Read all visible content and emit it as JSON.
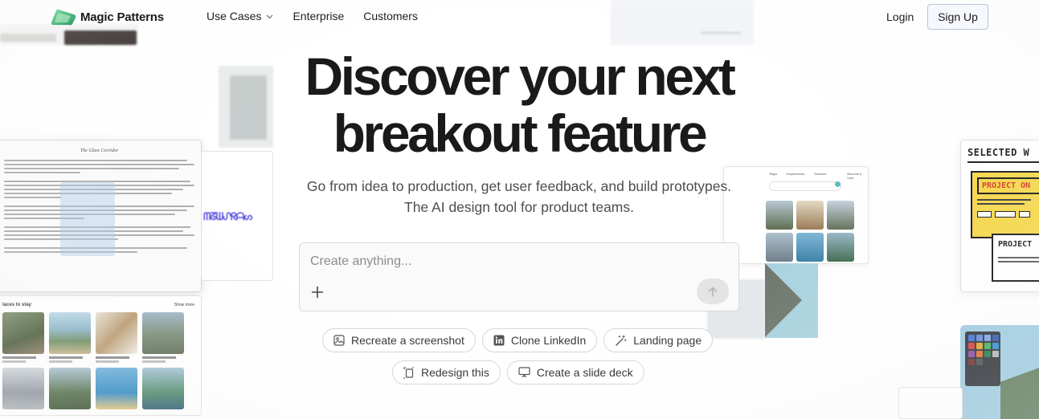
{
  "nav": {
    "brand": "Magic Patterns",
    "links": [
      {
        "label": "Use Cases",
        "has_dropdown": true
      },
      {
        "label": "Enterprise"
      },
      {
        "label": "Customers"
      }
    ],
    "login_label": "Login",
    "signup_label": "Sign Up"
  },
  "hero": {
    "title": "Discover your next breakout feature",
    "subtitle_line1": "Go from idea to production, get user feedback, and build prototypes.",
    "subtitle_line2": "The AI design tool for product teams."
  },
  "prompt": {
    "placeholder": "Create anything...",
    "value": ""
  },
  "suggestions": [
    {
      "label": "Recreate a screenshot",
      "icon": "image-icon"
    },
    {
      "label": "Clone LinkedIn",
      "icon": "linkedin-icon"
    },
    {
      "label": "Landing page",
      "icon": "magic-wand-icon"
    },
    {
      "label": "Redesign this",
      "icon": "redesign-icon"
    },
    {
      "label": "Create a slide deck",
      "icon": "presentation-icon"
    }
  ],
  "background": {
    "doc_title": "The Glass Corridor",
    "stays_heading": "laces to stay",
    "stays_more": "Show more",
    "selected_title": "SELECTED W",
    "project_one": "PROJECT ON",
    "project_two": "PROJECT"
  },
  "colors": {
    "accent_border": "#b9c3dc",
    "accent_fill": "#f6f8fd",
    "text": "#1a1a1a",
    "muted": "#4d4d4d"
  }
}
